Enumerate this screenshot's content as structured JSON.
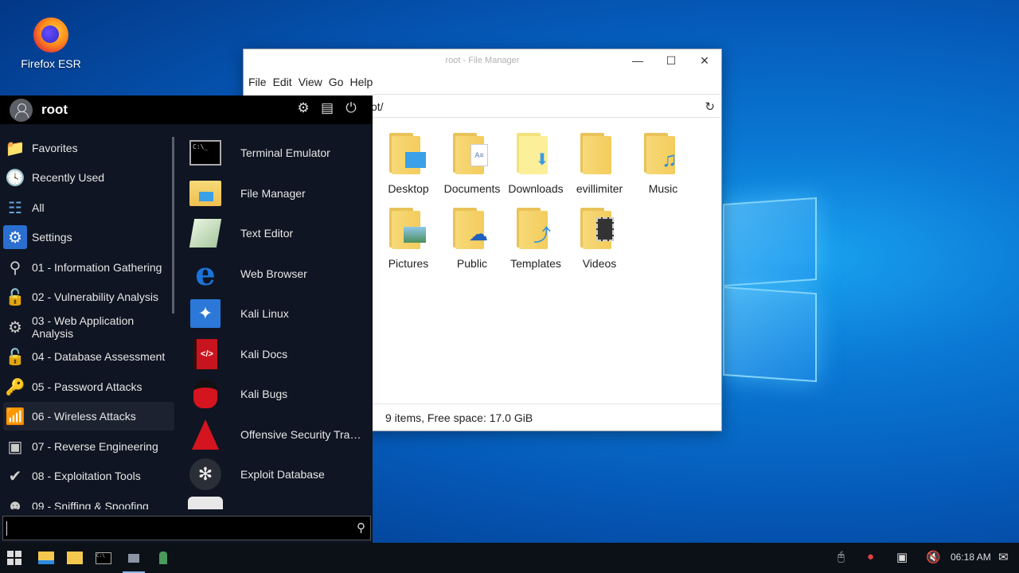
{
  "desktop": {
    "icons": [
      {
        "label": "Firefox ESR",
        "icon": "firefox-icon"
      }
    ]
  },
  "file_manager": {
    "title": "root - File Manager",
    "menu": [
      "File",
      "Edit",
      "View",
      "Go",
      "Help"
    ],
    "path": "ot/",
    "items": [
      {
        "label": "Desktop",
        "icon": "desktop-folder-icon"
      },
      {
        "label": "Documents",
        "icon": "documents-folder-icon"
      },
      {
        "label": "Downloads",
        "icon": "downloads-folder-icon"
      },
      {
        "label": "evillimiter",
        "icon": "folder-icon"
      },
      {
        "label": "Music",
        "icon": "music-folder-icon"
      },
      {
        "label": "Pictures",
        "icon": "pictures-folder-icon"
      },
      {
        "label": "Public",
        "icon": "public-folder-icon"
      },
      {
        "label": "Templates",
        "icon": "templates-folder-icon"
      },
      {
        "label": "Videos",
        "icon": "videos-folder-icon"
      }
    ],
    "status": "9 items, Free space: 17.0 GiB"
  },
  "start_menu": {
    "username": "root",
    "categories": [
      {
        "label": "Favorites",
        "icon": "favorites-icon"
      },
      {
        "label": "Recently Used",
        "icon": "recently-used-icon"
      },
      {
        "label": "All",
        "icon": "all-apps-icon"
      },
      {
        "label": "Settings",
        "icon": "settings-icon"
      },
      {
        "label": "01 - Information Gathering",
        "icon": "magnifier-icon"
      },
      {
        "label": "02 - Vulnerability Analysis",
        "icon": "vulnerability-icon"
      },
      {
        "label": "03 - Web Application Analysis",
        "icon": "web-app-icon"
      },
      {
        "label": "04 - Database Assessment",
        "icon": "database-icon"
      },
      {
        "label": "05 - Password Attacks",
        "icon": "key-icon"
      },
      {
        "label": "06 - Wireless Attacks",
        "icon": "wireless-icon"
      },
      {
        "label": "07 - Reverse Engineering",
        "icon": "reverse-engineering-icon"
      },
      {
        "label": "08 - Exploitation Tools",
        "icon": "exploit-icon"
      },
      {
        "label": "09 - Sniffing & Spoofing",
        "icon": "sniffing-icon"
      }
    ],
    "apps": [
      {
        "label": "Terminal Emulator",
        "icon": "terminal-icon"
      },
      {
        "label": "File Manager",
        "icon": "file-manager-icon"
      },
      {
        "label": "Text Editor",
        "icon": "text-editor-icon"
      },
      {
        "label": "Web Browser",
        "icon": "web-browser-icon"
      },
      {
        "label": "Kali Linux",
        "icon": "kali-linux-icon"
      },
      {
        "label": "Kali Docs",
        "icon": "kali-docs-icon"
      },
      {
        "label": "Kali Bugs",
        "icon": "kali-bugs-icon"
      },
      {
        "label": "Offensive Security Trai…",
        "icon": "offsec-icon"
      },
      {
        "label": "Exploit Database",
        "icon": "exploit-db-icon"
      }
    ],
    "search": {
      "placeholder": ""
    }
  },
  "taskbar": {
    "clock": "06:18 AM"
  }
}
